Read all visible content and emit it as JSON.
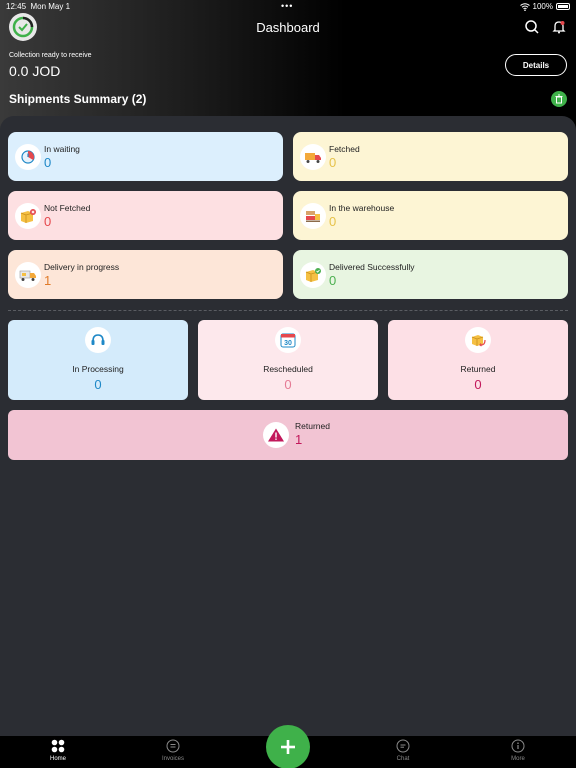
{
  "status_bar": {
    "time": "12:45",
    "date": "Mon May 1",
    "dots": "•••",
    "battery": "100%"
  },
  "header": {
    "title": "Dashboard",
    "collection_label": "Collection ready to receive",
    "collection_value": "0.0 JOD",
    "details_label": "Details",
    "summary_title": "Shipments Summary (2)"
  },
  "cards": [
    {
      "label": "In waiting",
      "value": "0",
      "bg": "#dceffd",
      "color": "#1e88c7",
      "icon": "clock-icon"
    },
    {
      "label": "Fetched",
      "value": "0",
      "bg": "#fdf5d4",
      "color": "#e6c24a",
      "icon": "truck-icon"
    },
    {
      "label": "Not Fetched",
      "value": "0",
      "bg": "#fde0e2",
      "color": "#e5484d",
      "icon": "box-x-icon"
    },
    {
      "label": "In the warehouse",
      "value": "0",
      "bg": "#fdf5d4",
      "color": "#e6c24a",
      "icon": "warehouse-icon"
    },
    {
      "label": "Delivery in progress",
      "value": "1",
      "bg": "#fde6d8",
      "color": "#e07b2a",
      "icon": "delivery-truck-icon"
    },
    {
      "label": "Delivered Successfully",
      "value": "0",
      "bg": "#e8f5e1",
      "color": "#4caf50",
      "icon": "box-check-icon"
    }
  ],
  "bottom_cards": [
    {
      "label": "In Processing",
      "value": "0",
      "bg": "#d4ebfb",
      "color": "#1e88c7",
      "icon": "headset-icon"
    },
    {
      "label": "Rescheduled",
      "value": "0",
      "bg": "#fde8ec",
      "color": "#e57a94",
      "icon": "calendar-icon",
      "icon_text": "30"
    },
    {
      "label": "Returned",
      "value": "0",
      "bg": "#fde0e6",
      "color": "#c2185b",
      "icon": "box-return-icon"
    }
  ],
  "wide_card": {
    "label": "Returned",
    "value": "1",
    "icon": "warning-icon"
  },
  "tabs": [
    {
      "label": "Home",
      "icon": "home-grid-icon",
      "active": true
    },
    {
      "label": "Invoices",
      "icon": "invoice-icon",
      "active": false
    },
    {
      "label": "Chat",
      "icon": "chat-icon",
      "active": false
    },
    {
      "label": "More",
      "icon": "more-icon",
      "active": false
    }
  ],
  "colors": {
    "accent": "#3fb14a",
    "background": "#2b2d33"
  }
}
